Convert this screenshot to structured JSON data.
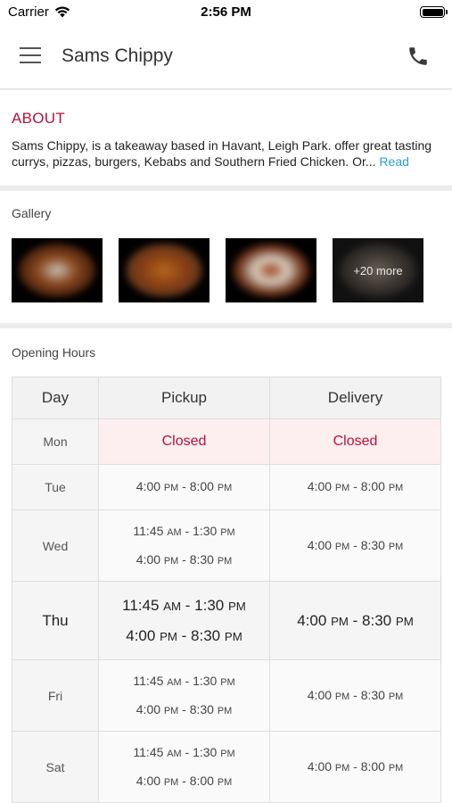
{
  "status": {
    "carrier": "Carrier",
    "time": "2:56 PM"
  },
  "nav": {
    "title": "Sams Chippy",
    "menu_icon": "hamburger-menu-icon",
    "phone_icon": "phone-icon"
  },
  "about": {
    "heading": "ABOUT",
    "text": "Sams Chippy, is a takeaway based in Havant, Leigh Park. offer great tasting currys, pizzas, burgers, Kebabs and Southern Fried Chicken. Or...",
    "read_more": "Read More"
  },
  "gallery": {
    "label": "Gallery",
    "more_label": "+20 more"
  },
  "hours": {
    "label": "Opening Hours",
    "headers": [
      "Day",
      "Pickup",
      "Delivery"
    ],
    "closed_color": "#b4123a",
    "rows": [
      {
        "day": "Mon",
        "pickup": [
          "Closed"
        ],
        "delivery": [
          "Closed"
        ],
        "closed": true
      },
      {
        "day": "Tue",
        "pickup": [
          "4:00 PM - 8:00 PM"
        ],
        "delivery": [
          "4:00 PM - 8:00 PM"
        ]
      },
      {
        "day": "Wed",
        "pickup": [
          "11:45 AM - 1:30 PM",
          "4:00 PM - 8:30 PM"
        ],
        "delivery": [
          "4:00 PM - 8:30 PM"
        ]
      },
      {
        "day": "Thu",
        "pickup": [
          "11:45 AM - 1:30 PM",
          "4:00 PM - 8:30 PM"
        ],
        "delivery": [
          "4:00 PM - 8:30 PM"
        ],
        "today": true
      },
      {
        "day": "Fri",
        "pickup": [
          "11:45 AM - 1:30 PM",
          "4:00 PM - 8:30 PM"
        ],
        "delivery": [
          "4:00 PM - 8:30 PM"
        ]
      },
      {
        "day": "Sat",
        "pickup": [
          "11:45 AM - 1:30 PM",
          "4:00 PM - 8:00 PM"
        ],
        "delivery": [
          "4:00 PM - 8:00 PM"
        ]
      }
    ]
  }
}
